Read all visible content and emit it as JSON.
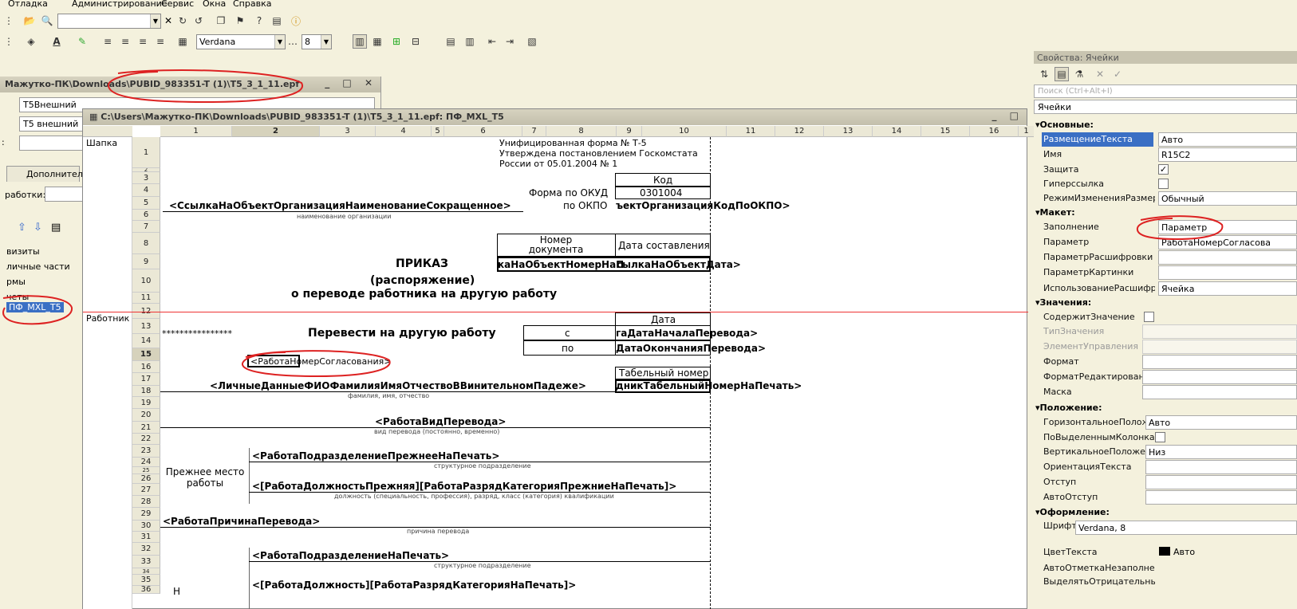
{
  "menu": [
    "Отладка",
    "Администрирование",
    "Сервис",
    "Окна",
    "Справка"
  ],
  "toolbar": {
    "font_name": "Verdana",
    "font_size": "8"
  },
  "win1": {
    "title": "Мажутко-ПК\\Downloads\\PUBID_983351-T (1)\\T5_3_1_11.epf",
    "field1": "T5Внешний",
    "field2": "Т5 внешний",
    "tab": "Дополнительн",
    "label_obrab": "работки:",
    "colon": ":",
    "tree": [
      "визиты",
      " личные части",
      "рмы",
      "четы",
      "ПФ_MXL_T5"
    ]
  },
  "win2": {
    "title": "C:\\Users\\Мажутко-ПК\\Downloads\\PUBID_983351-T (1)\\T5_3_1_11.epf: ПФ_MXL_T5"
  },
  "columns": [
    "1",
    "2",
    "3",
    "4",
    "5",
    "6",
    "7",
    "8",
    "9",
    "10",
    "11",
    "12",
    "13",
    "14",
    "15",
    "16",
    "1"
  ],
  "rows": [
    "1",
    "2",
    "3",
    "4",
    "5",
    "6",
    "7",
    "8",
    "9",
    "10",
    "11",
    "12",
    "13",
    "14",
    "15",
    "16",
    "17",
    "18",
    "19",
    "20",
    "21",
    "22",
    "23",
    "24",
    "25",
    "26",
    "27",
    "28",
    "29",
    "30",
    "31",
    "32",
    "33",
    "34",
    "35",
    "36"
  ],
  "sections": {
    "shapka": "Шапка",
    "rabotnik": "Работник"
  },
  "sheet": {
    "header1": "Унифицированная форма № Т-5",
    "header2": "Утверждена постановлением Госкомстата",
    "header3": "России от 05.01.2004 № 1",
    "kod": "Код",
    "forma_okud": "Форма по ОКУД",
    "okud": "0301004",
    "po_okpo": "по ОКПО",
    "org_name": "<СсылкаНаОбъектОрганизацияНаименованиеСокращенное>",
    "org_okpo": "ъектОрганизацияКодПоОКПО>",
    "org_caption": "наименование организации",
    "nomer_doc": "Номер документа",
    "data_sost": "Дата составления",
    "nomer_val": "каНаОбъектНомерНаП",
    "data_val": "сылкаНаОбъектДата>",
    "prikaz": "ПРИКАЗ",
    "rasp": "(распоряжение)",
    "o_perevode": "о переводе работника на другую работу",
    "data": "Дата",
    "stars": "****************",
    "perevesti": "Перевести на другую работу",
    "s": "с",
    "po": "по",
    "data_nach": "гаДатаНачалаПеревода>",
    "data_okonch": "ДатаОкончанияПеревода>",
    "soglas": "<РаботаНомерСогласования>",
    "tab_nomer": "Табельный номер",
    "fio": "<ЛичныеДанныеФИОФамилияИмяОтчествоВВинительномПадеже>",
    "tab_val": "дникТабельныйНомерНаПечать>",
    "fio_caption": "фамилия, имя, отчество",
    "vid": "<РаботаВидПеревода>",
    "vid_caption": "вид перевода (постоянно, временно)",
    "prezhnee": "Прежнее место работы",
    "podr_prezh": "<РаботаПодразделениеПрежнееНаПечать>",
    "podr_caption": "структурное подразделение",
    "dolzh_prezh": "<[РаботаДолжностьПрежняя][РаботаРазрядКатегорияПрежниеНаПечать]>",
    "dolzh_caption": "должность (специальность, профессия), разряд, класс (категория) квалификации",
    "prichina": "<РаботаПричинаПеревода>",
    "prichina_caption": "причина перевода",
    "podr": "<РаботаПодразделениеНаПечать>",
    "podr2_caption": "структурное подразделение",
    "dolzh": "<[РаботаДолжность][РаботаРазрядКатегорияНаПечать]>",
    "nov": "Н"
  },
  "props": {
    "title": "Свойства: Ячейки",
    "search_placeholder": "Поиск (Ctrl+Alt+I)",
    "object": "Ячейки",
    "groups": {
      "osn": "Основные:",
      "maket": "Макет:",
      "znach": "Значения:",
      "polozh": "Положение:",
      "oform": "Оформление:"
    },
    "rows": {
      "razm": [
        "РазмещениеТекста",
        "Авто"
      ],
      "imya": [
        "Имя",
        "R15C2"
      ],
      "zash": [
        "Защита",
        ""
      ],
      "giper": [
        "Гиперссылка",
        ""
      ],
      "rezhim": [
        "РежимИзмененияРазмераКо",
        "Обычный"
      ],
      "zapoln": [
        "Заполнение",
        "Параметр"
      ],
      "param": [
        "Параметр",
        "РаботаНомерСогласова"
      ],
      "paramr": [
        "ПараметрРасшифровки",
        ""
      ],
      "paramk": [
        "ПараметрКартинки",
        ""
      ],
      "ispr": [
        "ИспользованиеРасшифровки",
        "Ячейка"
      ],
      "sodzn": [
        "СодержитЗначение",
        ""
      ],
      "tipzn": [
        "ТипЗначения",
        ""
      ],
      "elupr": [
        "ЭлементУправления",
        ""
      ],
      "format": [
        "Формат",
        ""
      ],
      "formatred": [
        "ФорматРедактирования",
        ""
      ],
      "maska": [
        "Маска",
        ""
      ],
      "gorpol": [
        "ГоризонтальноеПоложение",
        "Авто"
      ],
      "povyd": [
        "ПоВыделеннымКолонкам",
        ""
      ],
      "vertpol": [
        "ВертикальноеПоложение",
        "Низ"
      ],
      "orient": [
        "ОриентацияТекста",
        ""
      ],
      "otstup": [
        "Отступ",
        ""
      ],
      "avtootst": [
        "АвтоОтступ",
        ""
      ],
      "shrift": [
        "Шрифт",
        "Verdana, 8"
      ],
      "cvet": [
        "ЦветТекста",
        "Авто"
      ],
      "avtootm": [
        "АвтоОтметкаНезаполненного",
        ""
      ],
      "vydotr": [
        "ВыделятьОтрицательные",
        ""
      ]
    }
  }
}
